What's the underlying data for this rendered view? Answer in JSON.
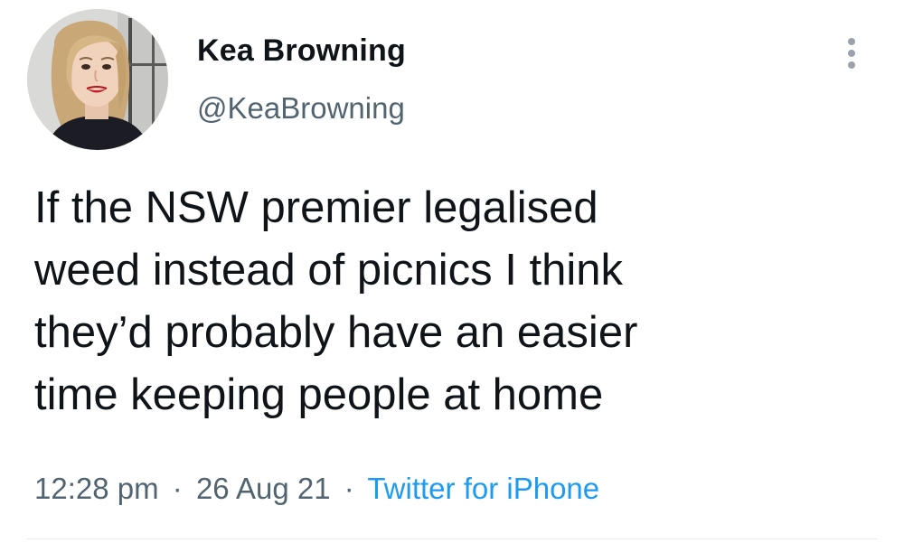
{
  "author": {
    "display_name": "Kea Browning",
    "handle": "@KeaBrowning",
    "avatar_icon": "profile-photo"
  },
  "tweet": {
    "lines": [
      "If the NSW premier legalised",
      "weed instead of picnics I think",
      "they’d probably have an easier",
      "time keeping people at home"
    ]
  },
  "meta": {
    "time": "12:28 pm",
    "separator": "·",
    "date": "26 Aug 21",
    "source": "Twitter for iPhone"
  },
  "more_icon": "more-vertical-icon",
  "colors": {
    "text": "#0f1419",
    "secondary": "#536471",
    "link": "#1d9bf0",
    "divider": "#e6ecf0"
  }
}
